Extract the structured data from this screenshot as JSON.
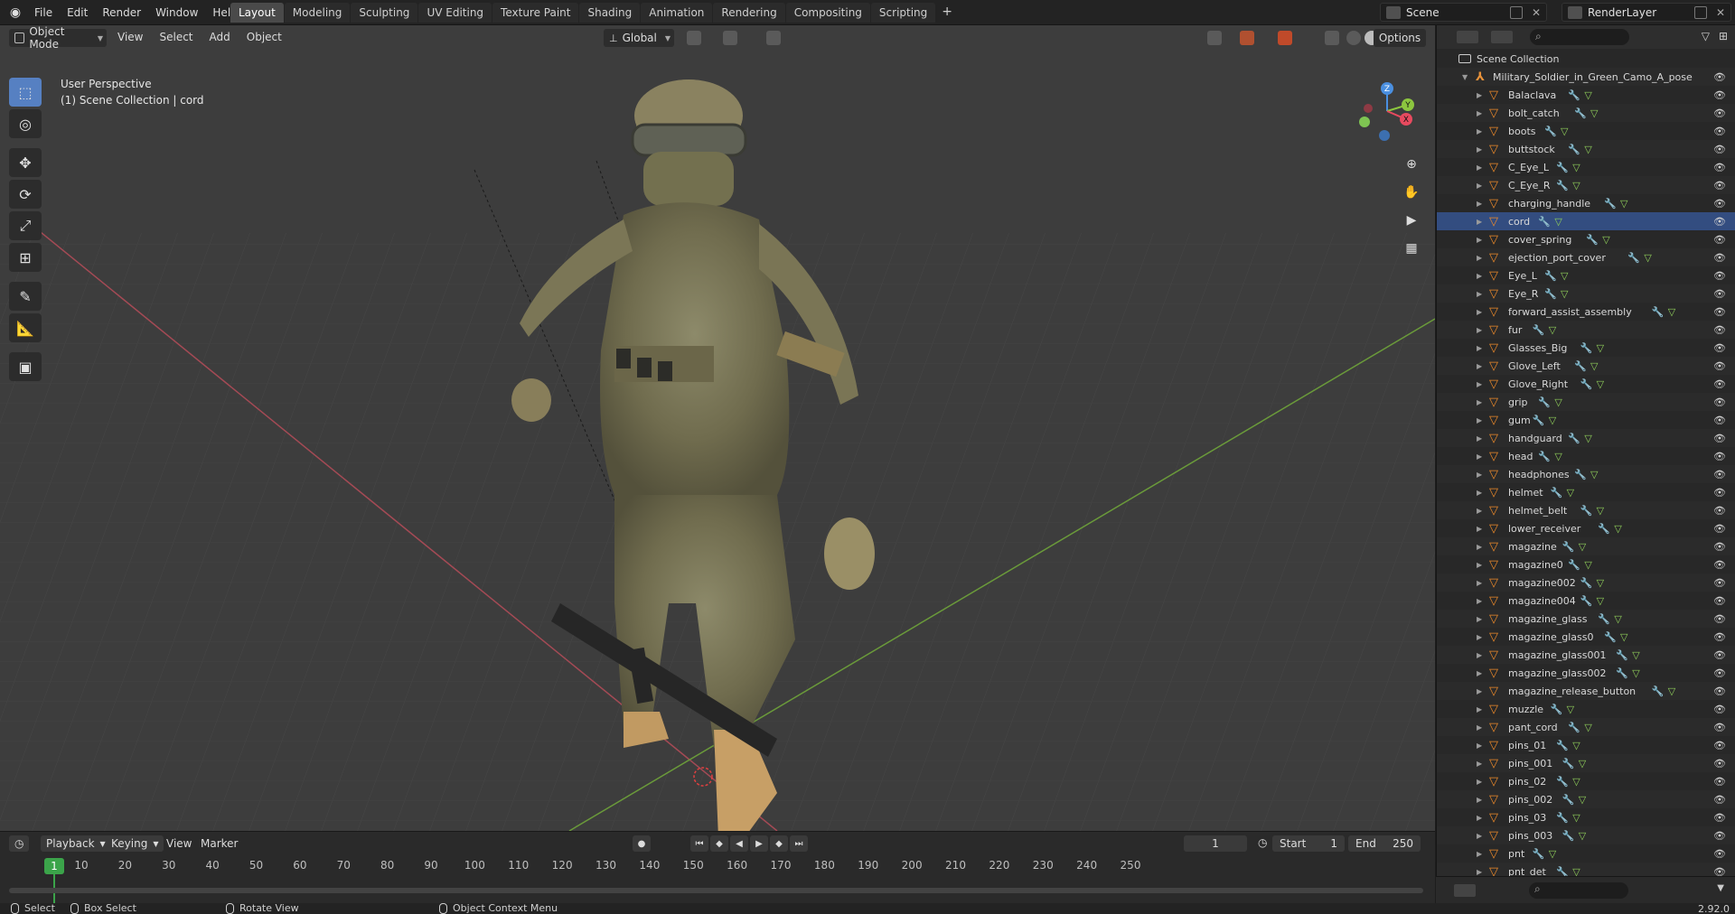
{
  "topbar": {
    "menu": [
      "File",
      "Edit",
      "Render",
      "Window",
      "Help"
    ],
    "workspaces": [
      "Layout",
      "Modeling",
      "Sculpting",
      "UV Editing",
      "Texture Paint",
      "Shading",
      "Animation",
      "Rendering",
      "Compositing",
      "Scripting"
    ],
    "add_tab": "+",
    "scene": "Scene",
    "render_layer": "RenderLayer"
  },
  "viewport": {
    "mode": "Object Mode",
    "menu": [
      "View",
      "Select",
      "Add",
      "Object"
    ],
    "orientation": "Global",
    "options": "Options",
    "info_line1": "User Perspective",
    "info_line2": "(1) Scene Collection | cord",
    "gizmo_axes": {
      "x": "X",
      "y": "Y",
      "z": "Z"
    }
  },
  "timeline": {
    "playback": "Playback",
    "keying": "Keying",
    "view": "View",
    "marker": "Marker",
    "current_frame": "1",
    "start_label": "Start",
    "start": "1",
    "end_label": "End",
    "end": "250",
    "ruler": [
      "10",
      "20",
      "30",
      "40",
      "50",
      "60",
      "70",
      "80",
      "90",
      "100",
      "110",
      "120",
      "130",
      "140",
      "150",
      "160",
      "170",
      "180",
      "190",
      "200",
      "210",
      "220",
      "230",
      "240",
      "250"
    ]
  },
  "statusbar": {
    "select": "Select",
    "box_select": "Box Select",
    "rotate_view": "Rotate View",
    "context_menu": "Object Context Menu",
    "version": "2.92.0"
  },
  "outliner": {
    "scene_collection": "Scene Collection",
    "root": "Military_Soldier_in_Green_Camo_A_pose",
    "selected": "cord",
    "items": [
      "Balaclava",
      "bolt_catch",
      "boots",
      "buttstock",
      "C_Eye_L",
      "C_Eye_R",
      "charging_handle",
      "cord",
      "cover_spring",
      "ejection_port_cover",
      "Eye_L",
      "Eye_R",
      "forward_assist_assembly",
      "fur",
      "Glasses_Big",
      "Glove_Left",
      "Glove_Right",
      "grip",
      "gum",
      "handguard",
      "head",
      "headphones",
      "helmet",
      "helmet_belt",
      "lower_receiver",
      "magazine",
      "magazine0",
      "magazine002",
      "magazine004",
      "magazine_glass",
      "magazine_glass0",
      "magazine_glass001",
      "magazine_glass002",
      "magazine_release_button",
      "muzzle",
      "pant_cord",
      "pins_01",
      "pins_001",
      "pins_02",
      "pins_002",
      "pins_03",
      "pins_003",
      "pnt",
      "pnt_det"
    ]
  },
  "colors": {
    "viewport_bg": "#3d3d3d",
    "accent": "#5680c2",
    "axis_x": "#e84a5f",
    "axis_y": "#8cc63f",
    "axis_z": "#4a8fe0",
    "playhead": "#3ba44a",
    "object_icon": "#ee8a2a"
  }
}
